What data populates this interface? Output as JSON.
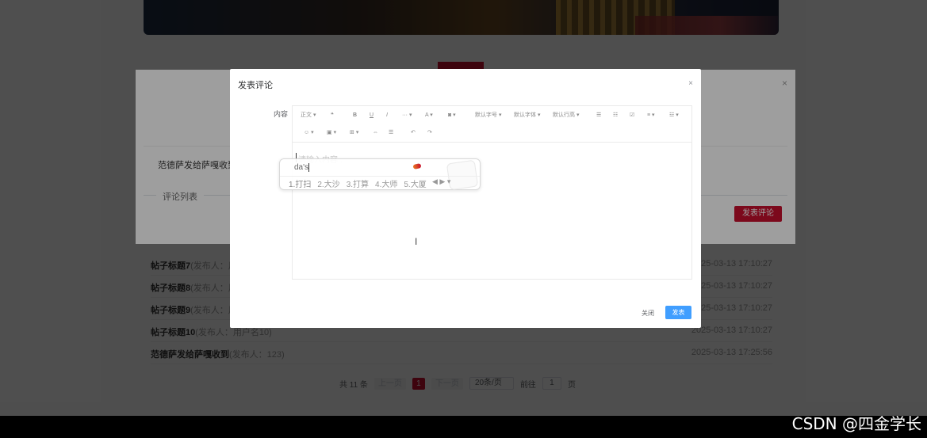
{
  "background": {
    "posts": [
      {
        "title": "帖子标题7",
        "meta": "(发布人：用户...",
        "time": "2025-03-13 17:10:27"
      },
      {
        "title": "帖子标题8",
        "meta": "(发布人：用户...",
        "time": "2025-03-13 17:10:27"
      },
      {
        "title": "帖子标题9",
        "meta": "(发布人：用户...",
        "time": "2025-03-13 17:10:27"
      },
      {
        "title": "帖子标题10",
        "meta": "(发布人：用户名10)",
        "time": "2025-03-13 17:10:27"
      },
      {
        "title": "范德萨发给萨嘎收到",
        "meta": "(发布人：123)",
        "time": "2025-03-13 17:25:56"
      }
    ],
    "pagination": {
      "total": "共 11 条",
      "prev": "上一页",
      "current": "1",
      "next": "下一页",
      "page_size": "20条/页",
      "goto_label": "前往",
      "goto_value": "1",
      "page_unit": "页"
    }
  },
  "dialog1": {
    "post_line": "范德萨发给萨嘎收到范",
    "section_label": "评论列表",
    "submit_button": "发表评论",
    "close": "×"
  },
  "modal": {
    "title": "发表评论",
    "close": "×",
    "content_label": "内容",
    "toolbar": {
      "row1": [
        "正文",
        "❝",
        "B",
        "U",
        "I",
        "···",
        "A",
        "◙",
        "默认字号",
        "默认字体",
        "默认行高",
        "☰",
        "☷",
        "☑",
        "≡",
        "☳"
      ],
      "row2": [
        "☺",
        "▣",
        "⊞",
        "⇔",
        "☰",
        "↶",
        "↷"
      ]
    },
    "placeholder": "请输入内容...",
    "ime": {
      "input": "da's",
      "candidates": [
        "1.打扫",
        "2.大沙",
        "3.打算",
        "4.大师",
        "5.大厦"
      ],
      "arrows": "◀ ▶ ▾"
    },
    "cancel_button": "关闭",
    "ok_button": "发表"
  },
  "watermark": "CSDN @四金学长"
}
